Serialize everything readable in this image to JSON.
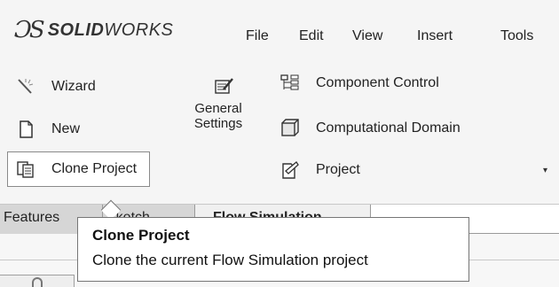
{
  "app": {
    "brand_prefix": "SOLID",
    "brand_suffix": "WORKS"
  },
  "menu": {
    "items": [
      "File",
      "Edit",
      "View",
      "Insert",
      "Tools"
    ]
  },
  "ribbon": {
    "wizard": "Wizard",
    "new": "New",
    "clone_project": "Clone Project",
    "general_settings_line1": "General",
    "general_settings_line2": "Settings",
    "component_control": "Component Control",
    "computational_domain": "Computational Domain",
    "project": "Project",
    "project_arrow": "▾"
  },
  "tabs": {
    "features": "Features",
    "sketch": "Sketch",
    "flow_simulation": "Flow Simulation"
  },
  "tooltip": {
    "title": "Clone Project",
    "description": "Clone the current Flow Simulation project"
  }
}
